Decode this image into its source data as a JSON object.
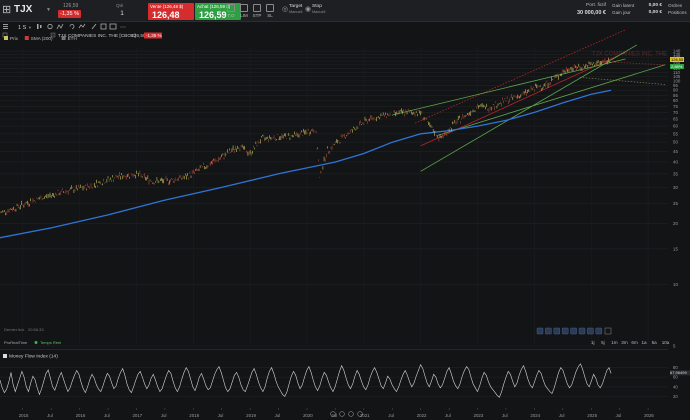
{
  "order_bar": {
    "symbol": "TJX",
    "last_price": "126,59",
    "last_change": "-1,35 %",
    "quantity_label": "Qté",
    "quantity": "1",
    "sell_label": "Vente (126,48 $)",
    "sell_price": "126,48",
    "buy_label": "Achat (126,59 $)",
    "buy_price": "126,59",
    "order_types": [
      "T.O",
      "LIM",
      "STP",
      "SL"
    ],
    "target_title": "Target",
    "target_sub": "Manuell",
    "stop_title": "Stop",
    "stop_sub": "Manuell",
    "portfolio_label": "Port. fictif",
    "portfolio_value": "30 000,00 €",
    "gain_labels": [
      "Gain latent",
      "Gain jour"
    ],
    "gain_values": [
      "0,00 €",
      "0,00 €"
    ],
    "order_labels": [
      "Ordres",
      "Positions"
    ]
  },
  "chart_toolbar": {
    "period": "1 S",
    "icons": [
      "candles-icon",
      "settings-icon",
      "indicators-icon",
      "undo-icon",
      "compare-icon",
      "draw-icon",
      "save-icon",
      "layout-icon",
      "more-icon"
    ]
  },
  "chart_info": {
    "instrument": "TJX COMPANIES INC. THE [CBOE]",
    "instrument_value": "126,59",
    "instrument_change": "-1,35 %",
    "legend": [
      {
        "label": "Prix",
        "color": "#c9c36a"
      },
      {
        "label": "SMA (200)",
        "color": "#d03a3a"
      },
      {
        "label": "ETH",
        "color": "#777777"
      }
    ]
  },
  "watermark": "TJX COMPANIES INC. THE",
  "price_axis": {
    "ticks": [
      140,
      135,
      130,
      125,
      120,
      115,
      110,
      105,
      100,
      95,
      90,
      85,
      80,
      75,
      70,
      65,
      60,
      55,
      50,
      45,
      40,
      35,
      30,
      25,
      20,
      15,
      10,
      5
    ],
    "price_tag_1": "126,55",
    "price_tag_2": "2,88%"
  },
  "chart_footer": {
    "last_tick": "Dernier tick",
    "last_tick_time": "20:56:33",
    "realtime_label": "ProRealTime",
    "realtime_status": "Temps Réel"
  },
  "range_buttons": [
    "1j",
    "5j",
    "1m",
    "3m",
    "6m",
    "1a",
    "5a",
    "10a"
  ],
  "mfi": {
    "label": "Money Flow Index (14)",
    "axis_value": "67,96499",
    "ticks": [
      80,
      60,
      40,
      20
    ],
    "values": [
      54,
      38,
      28,
      35,
      50,
      70,
      45,
      30,
      44,
      58,
      72,
      60,
      40,
      30,
      48,
      62,
      55,
      38,
      24,
      36,
      52,
      68,
      75,
      58,
      40,
      33,
      46,
      60,
      70,
      56,
      42,
      30,
      38,
      52,
      64,
      74,
      66,
      50,
      36,
      28,
      40,
      55,
      66,
      58,
      44,
      35,
      30,
      42,
      56,
      68,
      62,
      48,
      36,
      42,
      58,
      70,
      78,
      64,
      46,
      34,
      28,
      40,
      54,
      66,
      72,
      60,
      46,
      36,
      44,
      58,
      66,
      54,
      40,
      30,
      36,
      50,
      64,
      74,
      68,
      52,
      38,
      30,
      40,
      56,
      70,
      80,
      72,
      56,
      40,
      32,
      44,
      60,
      68,
      56,
      42,
      34,
      38,
      52,
      66,
      76,
      82,
      70,
      54,
      38,
      30,
      36,
      50,
      64,
      70,
      60,
      44,
      34,
      30,
      42,
      56,
      70,
      78,
      66,
      50,
      38,
      30,
      40,
      58,
      72,
      80,
      68,
      52,
      40,
      32,
      24,
      20,
      30,
      46,
      62,
      72,
      64,
      48,
      36,
      44,
      60,
      74,
      82,
      70,
      54,
      40,
      32,
      42,
      58,
      70,
      64,
      50,
      38,
      30,
      40,
      56,
      72,
      84,
      74,
      58,
      44,
      36,
      46,
      62,
      74,
      66,
      52,
      40,
      34,
      44,
      60,
      72,
      80,
      70,
      56,
      42,
      36,
      48,
      62,
      56,
      44,
      36,
      30,
      40,
      54,
      66,
      74,
      64,
      50,
      40,
      48,
      62,
      74,
      86,
      78,
      62,
      48,
      40,
      52,
      66,
      60,
      46,
      38,
      44,
      58,
      72,
      80,
      68,
      52,
      42,
      36,
      46,
      62,
      74,
      82,
      76,
      60,
      46,
      38,
      30,
      42,
      58,
      70,
      64,
      50,
      40,
      34,
      28,
      22,
      18,
      30,
      46,
      60,
      72,
      66,
      52,
      40,
      48,
      64,
      76,
      84,
      72,
      56,
      44,
      38,
      50,
      64,
      74,
      68,
      54,
      42,
      36,
      30,
      26,
      38,
      54,
      70,
      80,
      74,
      60,
      46,
      38,
      44,
      58,
      72,
      82,
      88,
      76,
      60,
      46,
      40,
      52,
      66,
      58,
      44,
      38,
      46,
      60,
      74,
      80,
      68
    ]
  },
  "time_axis": [
    "2015",
    "Jul",
    "2016",
    "Jul",
    "2017",
    "Jul",
    "2018",
    "Jul",
    "2019",
    "Jul",
    "2020",
    "Jul",
    "2021",
    "Jul",
    "2022",
    "Jul",
    "2023",
    "Jul",
    "2024",
    "Jul",
    "2025",
    "Jul",
    "2026"
  ],
  "chart_data": {
    "type": "line",
    "title": "TJX COMPANIES INC. THE [CBOE]",
    "x_unit": "year",
    "ylim": [
      5,
      145
    ],
    "log_scale": true,
    "grid": true,
    "series": [
      {
        "name": "Prix",
        "x": [
          2014.6,
          2014.9,
          2015.2,
          2015.5,
          2015.8,
          2016.1,
          2016.4,
          2016.7,
          2017.0,
          2017.3,
          2017.6,
          2017.9,
          2018.2,
          2018.5,
          2018.8,
          2019.0,
          2019.2,
          2019.5,
          2019.8,
          2020.0,
          2020.15,
          2020.22,
          2020.35,
          2020.6,
          2020.9,
          2021.1,
          2021.4,
          2021.7,
          2022.0,
          2022.15,
          2022.35,
          2022.45,
          2022.6,
          2022.8,
          2023.0,
          2023.2,
          2023.4,
          2023.6,
          2023.8,
          2024.0,
          2024.2,
          2024.4,
          2024.6,
          2024.8,
          2025.0,
          2025.2,
          2025.35
        ],
        "values": [
          22.5,
          24,
          26,
          27.5,
          29,
          30,
          32,
          34,
          35,
          32,
          32.5,
          34,
          38,
          42,
          48,
          44,
          52,
          53,
          54,
          56,
          58,
          33,
          45,
          52,
          60,
          65,
          68,
          70,
          70,
          60,
          52,
          56,
          62,
          68,
          75,
          74,
          78,
          82,
          86,
          92,
          96,
          105,
          115,
          117,
          120,
          124,
          126.59
        ]
      },
      {
        "name": "SMA (200)",
        "x": [
          2014.6,
          2015.5,
          2016.5,
          2017.5,
          2018.5,
          2019.5,
          2020.5,
          2021.0,
          2021.5,
          2022.0,
          2022.5,
          2023.0,
          2023.5,
          2024.0,
          2024.5,
          2025.0,
          2025.35
        ],
        "values": [
          17,
          19,
          22,
          26,
          30,
          35,
          40,
          44,
          50,
          55,
          57,
          60,
          64,
          70,
          78,
          86,
          90
        ]
      }
    ],
    "ylabel": "",
    "xlabel": ""
  }
}
